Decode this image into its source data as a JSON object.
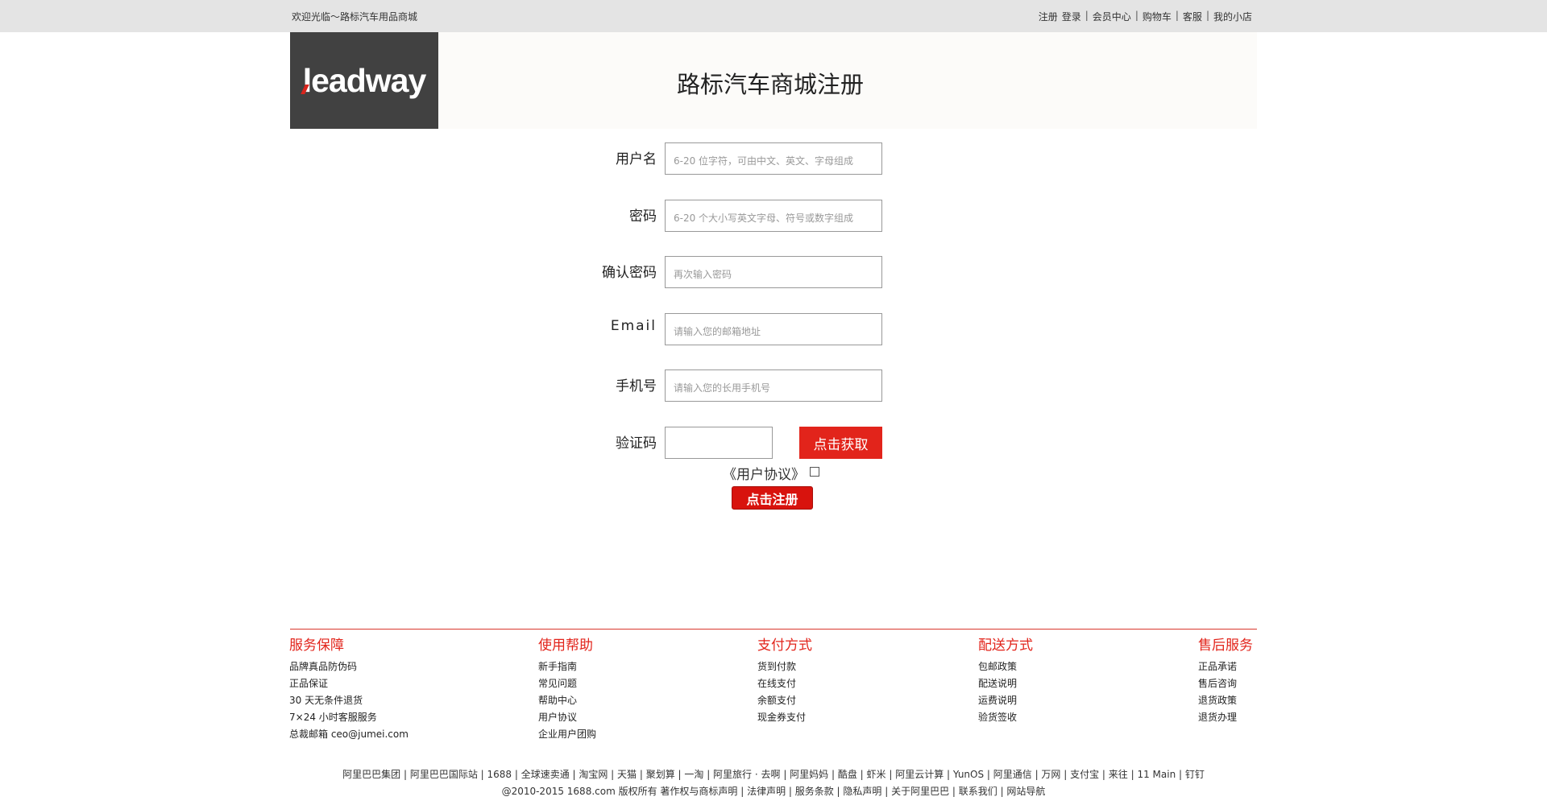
{
  "topbar": {
    "welcome": "欢迎光临～路标汽车用品商城",
    "links": {
      "register": "注册",
      "login": "登录",
      "member": "会员中心",
      "cart": "购物车",
      "service": "客服",
      "shop": "我的小店"
    }
  },
  "header": {
    "logo_text": "leadway",
    "title": "路标汽车商城注册"
  },
  "form": {
    "username": {
      "label": "用户名",
      "placeholder": "6-20 位字符，可由中文、英文、字母组成"
    },
    "password": {
      "label": "密码",
      "placeholder": "6-20 个大小写英文字母、符号或数字组成"
    },
    "confirm": {
      "label": "确认密码",
      "placeholder": "再次输入密码"
    },
    "email": {
      "label": "Email",
      "placeholder": "请输入您的邮箱地址"
    },
    "phone": {
      "label": "手机号",
      "placeholder": "请输入您的长用手机号"
    },
    "code": {
      "label": "验证码",
      "placeholder": "",
      "button": "点击获取"
    },
    "agreement": "《用户协议》",
    "submit": "点击注册"
  },
  "footer": {
    "columns": [
      {
        "title": "服务保障",
        "items": [
          "品牌真品防伪码",
          "正品保证",
          "30 天无条件退货",
          "7×24 小时客服服务",
          "总裁邮箱 ceo@jumei.com"
        ]
      },
      {
        "title": "使用帮助",
        "items": [
          "新手指南",
          "常见问题",
          "帮助中心",
          "用户协议",
          "企业用户团购"
        ]
      },
      {
        "title": "支付方式",
        "items": [
          "货到付款",
          "在线支付",
          "余额支付",
          "现金券支付"
        ]
      },
      {
        "title": "配送方式",
        "items": [
          "包邮政策",
          "配送说明",
          "运费说明",
          "验货签收"
        ]
      },
      {
        "title": "售后服务",
        "items": [
          "正品承诺",
          "售后咨询",
          "退货政策",
          "退货办理"
        ]
      }
    ],
    "links_line": "阿里巴巴集团 | 阿里巴巴国际站 | 1688 | 全球速卖通 | 淘宝网 | 天猫 | 聚划算 | 一淘 | 阿里旅行 · 去啊 | 阿里妈妈 | 酷盘 | 虾米 | 阿里云计算 | YunOS | 阿里通信 | 万网 | 支付宝 | 来往 | 11 Main | 钉钉",
    "copyright": "@2010-2015 1688.com 版权所有 著作权与商标声明 | 法律声明 | 服务条款 | 隐私声明 | 关于阿里巴巴 | 联系我们 | 网站导航"
  }
}
